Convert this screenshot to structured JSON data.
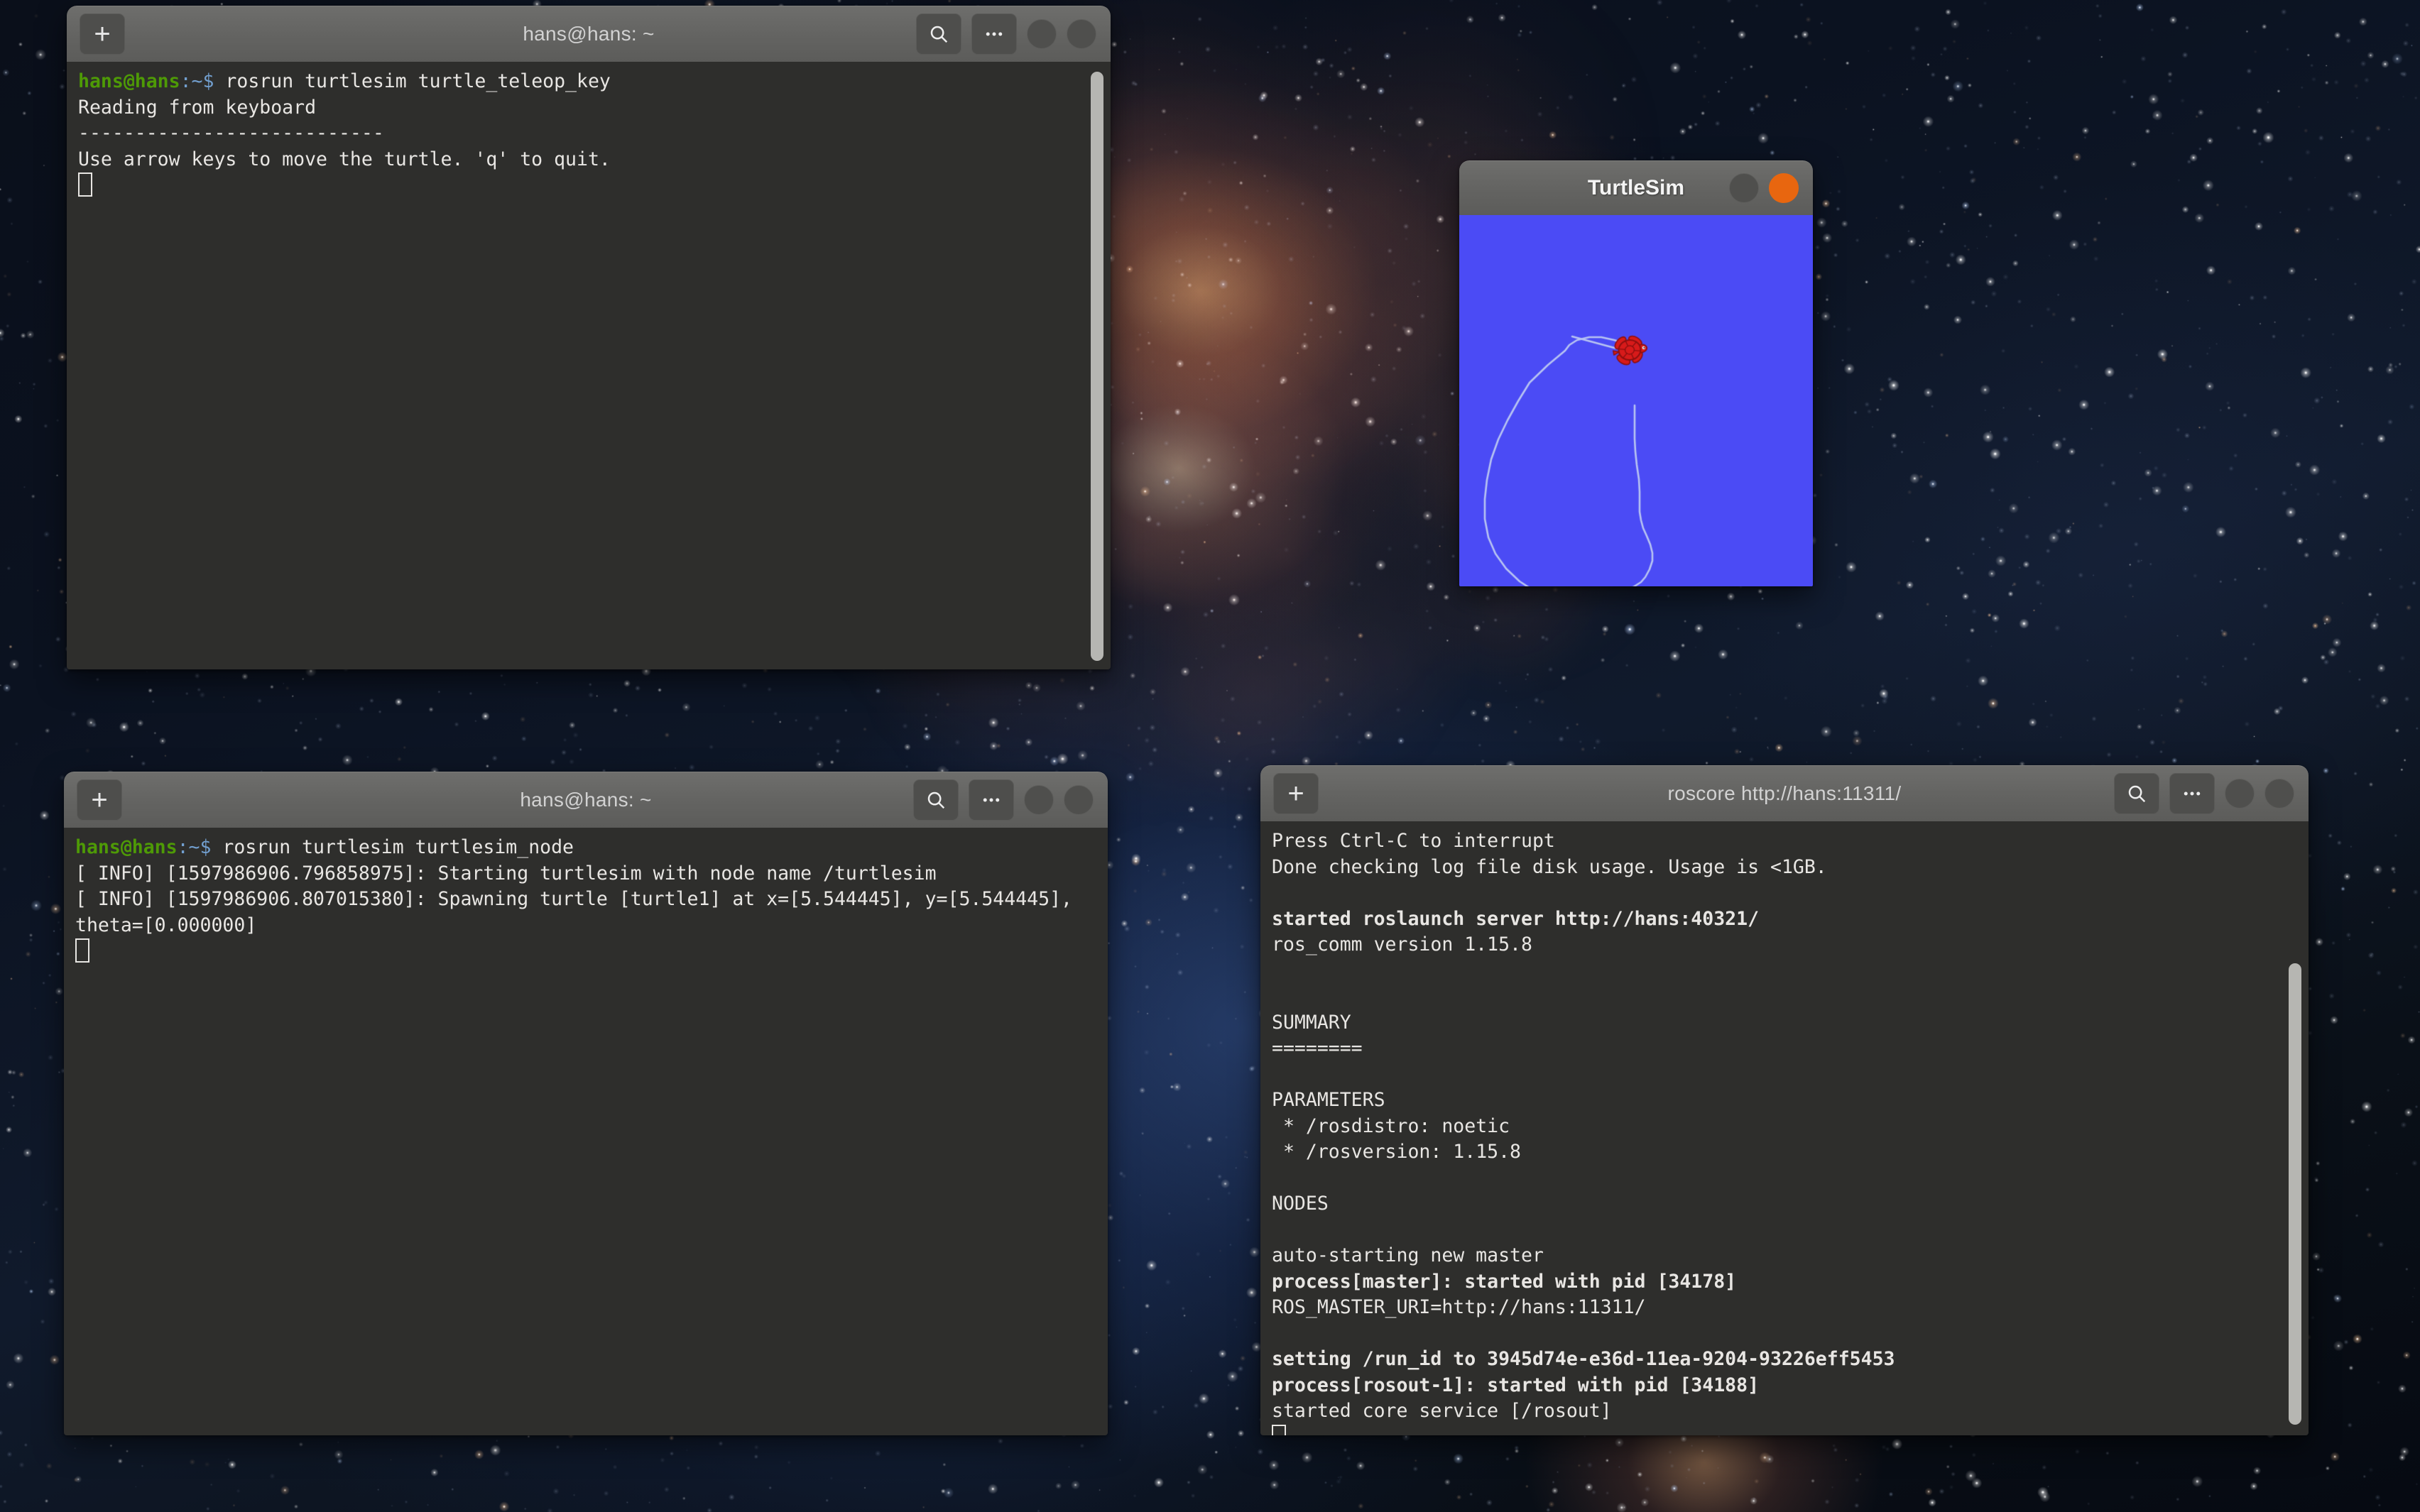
{
  "desktop": {
    "wallpaper_name": "space-nebula-wallpaper",
    "background_color": "#0a0f1a"
  },
  "windows": {
    "teleop_terminal": {
      "title": "hans@hans: ~",
      "new_tab_label": "+",
      "search_icon": "search-icon",
      "menu_icon": "overflow-menu-icon",
      "minimize_icon": "minimize-button",
      "close_icon": "close-button",
      "lines": [
        {
          "prompt": "hans@hans",
          "tilde": ":~$ ",
          "text": "rosrun turtlesim turtle_teleop_key",
          "bold": false
        },
        {
          "text": "Reading from keyboard",
          "bold": false
        },
        {
          "text": "---------------------------",
          "bold": false
        },
        {
          "text": "Use arrow keys to move the turtle. 'q' to quit.",
          "bold": false
        }
      ]
    },
    "turtlesim": {
      "title": "TurtleSim",
      "minimize_icon": "minimize-button",
      "close_icon": "close-button",
      "canvas_color": "#4b4bf5",
      "turtle_color": "#d81a1a",
      "trail_color": "#b8c4f2"
    },
    "node_terminal": {
      "title": "hans@hans: ~",
      "new_tab_label": "+",
      "search_icon": "search-icon",
      "menu_icon": "overflow-menu-icon",
      "minimize_icon": "minimize-button",
      "close_icon": "close-button",
      "lines": [
        {
          "prompt": "hans@hans",
          "tilde": ":~$ ",
          "text": "rosrun turtlesim turtlesim_node",
          "bold": false
        },
        {
          "text": "[ INFO] [1597986906.796858975]: Starting turtlesim with node name /turtlesim",
          "bold": false
        },
        {
          "text": "[ INFO] [1597986906.807015380]: Spawning turtle [turtle1] at x=[5.544445], y=[5.544445], theta=[0.000000]",
          "bold": false
        }
      ]
    },
    "roscore_terminal": {
      "title": "roscore http://hans:11311/",
      "new_tab_label": "+",
      "search_icon": "search-icon",
      "menu_icon": "overflow-menu-icon",
      "minimize_icon": "minimize-button",
      "close_icon": "close-button",
      "lines": [
        {
          "text": "Press Ctrl-C to interrupt",
          "bold": false
        },
        {
          "text": "Done checking log file disk usage. Usage is <1GB.",
          "bold": false
        },
        {
          "text": "",
          "bold": false
        },
        {
          "text": "started roslaunch server http://hans:40321/",
          "bold": true
        },
        {
          "text": "ros_comm version 1.15.8",
          "bold": false
        },
        {
          "text": "",
          "bold": false
        },
        {
          "text": "",
          "bold": false
        },
        {
          "text": "SUMMARY",
          "bold": false
        },
        {
          "text": "========",
          "bold": false
        },
        {
          "text": "",
          "bold": false
        },
        {
          "text": "PARAMETERS",
          "bold": false
        },
        {
          "text": " * /rosdistro: noetic",
          "bold": false
        },
        {
          "text": " * /rosversion: 1.15.8",
          "bold": false
        },
        {
          "text": "",
          "bold": false
        },
        {
          "text": "NODES",
          "bold": false
        },
        {
          "text": "",
          "bold": false
        },
        {
          "text": "auto-starting new master",
          "bold": false
        },
        {
          "text": "process[master]: started with pid [34178]",
          "bold": true
        },
        {
          "text": "ROS_MASTER_URI=http://hans:11311/",
          "bold": false
        },
        {
          "text": "",
          "bold": false
        },
        {
          "text": "setting /run_id to 3945d74e-e36d-11ea-9204-93226eff5453",
          "bold": true
        },
        {
          "text": "process[rosout-1]: started with pid [34188]",
          "bold": true
        },
        {
          "text": "started core service [/rosout]",
          "bold": false
        }
      ]
    }
  }
}
